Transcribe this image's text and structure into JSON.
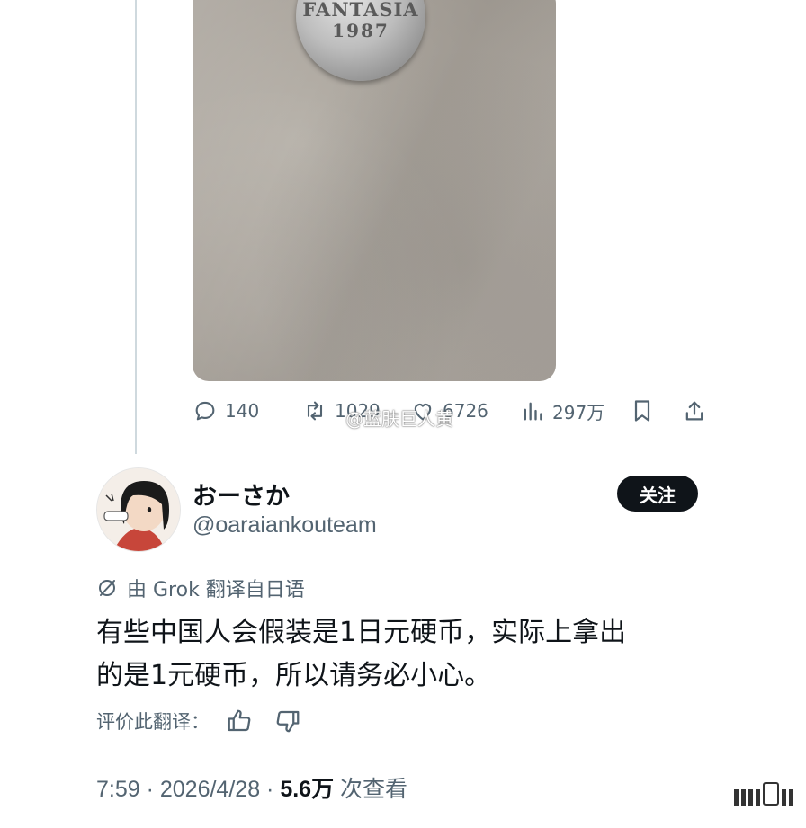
{
  "photo": {
    "coin_text": "FANTASIA",
    "coin_year": "1987"
  },
  "actions": {
    "reply_count": "140",
    "retweet_count": "1029",
    "like_count": "6726",
    "views_count": "297万"
  },
  "watermark": "@蓝肤巨人黄",
  "user": {
    "display_name": "おーさか",
    "handle": "@oaraiankouteam",
    "follow_label": "关注"
  },
  "translation_note": "由 Grok 翻译自日语",
  "tweet": {
    "line1": "有些中国人会假装是1日元硬币，实际上拿出",
    "line2": "的是1元硬币，所以请务必小心。"
  },
  "rate_label": "评价此翻译：",
  "meta": {
    "time_date": "7:59 · 2026/4/28 · ",
    "views": "5.6万",
    "views_suffix": " 次查看"
  },
  "colors": {
    "text": "#0f1419",
    "secondary": "#536471",
    "button_bg": "#0f1419",
    "thread_line": "#cfd9de"
  }
}
